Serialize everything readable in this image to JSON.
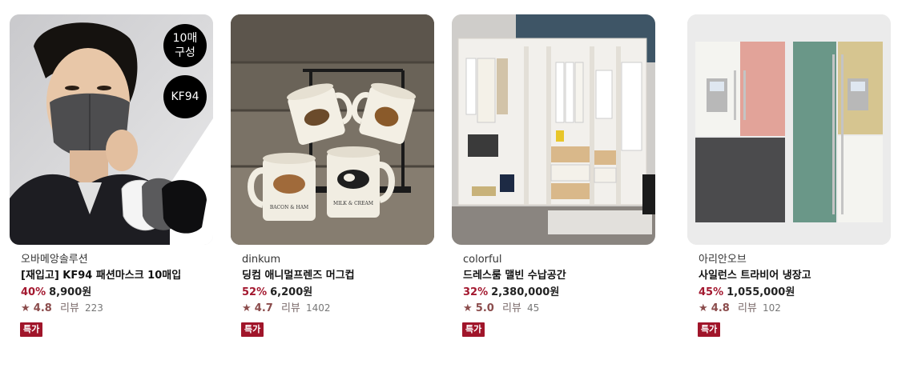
{
  "products": [
    {
      "brand": "오바메앙솔루션",
      "name": "[재입고] KF94 패션마스크 10매입",
      "discount": "40%",
      "price": "8,900원",
      "star": "★",
      "rating": "4.8",
      "review_label": "리뷰",
      "review_count": "223",
      "badge": "특가",
      "badges_on_image": [
        "10매\n구성",
        "KF94"
      ]
    },
    {
      "brand": "dinkum",
      "name": "딩컴 애니멀프렌즈 머그컵",
      "discount": "52%",
      "price": "6,200원",
      "star": "★",
      "rating": "4.7",
      "review_label": "리뷰",
      "review_count": "1402",
      "badge": "특가",
      "mug_texts": [
        "BACON & HAM",
        "MILK & CREAM"
      ]
    },
    {
      "brand": "colorful",
      "name": "드레스룸 맬빈 수납공간",
      "discount": "32%",
      "price": "2,380,000원",
      "star": "★",
      "rating": "5.0",
      "review_label": "리뷰",
      "review_count": "45",
      "badge": "특가"
    },
    {
      "brand": "아리안오브",
      "name": "사일런스 트라비어 냉장고",
      "discount": "45%",
      "price": "1,055,000원",
      "star": "★",
      "rating": "4.8",
      "review_label": "리뷰",
      "review_count": "102",
      "badge": "특가"
    }
  ],
  "colors": {
    "discount": "#a3182f",
    "badge_bg": "#a0152a",
    "rating": "#8b4c4c"
  }
}
